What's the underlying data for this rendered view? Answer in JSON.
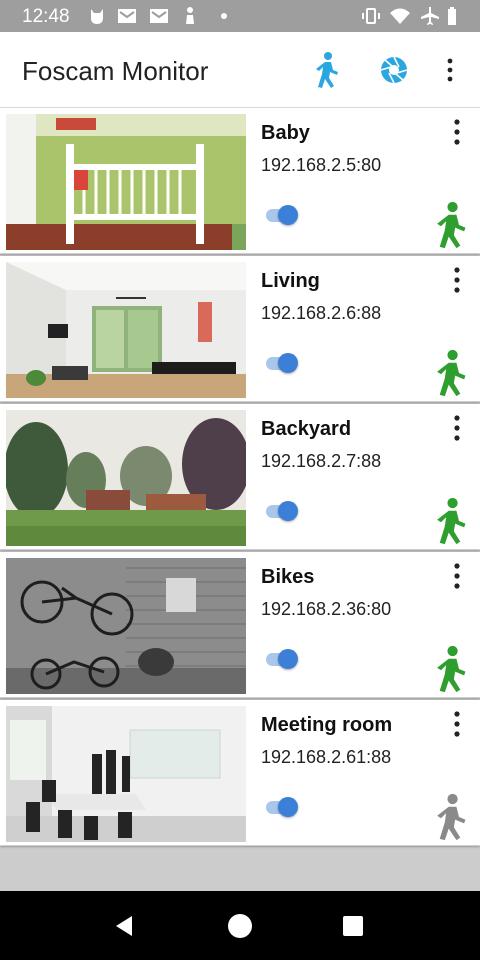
{
  "status_bar": {
    "time": "12:48",
    "left_icons": [
      "cat-notification-icon",
      "mail-icon",
      "mail-icon",
      "person-notification-icon",
      "dot-icon"
    ],
    "right_icons": [
      "vibrate-icon",
      "wifi-icon",
      "airplane-icon",
      "battery-icon"
    ]
  },
  "app_bar": {
    "title": "Foscam Monitor",
    "actions": [
      "motion-walk-icon",
      "camera-shutter-icon",
      "more-vert-icon"
    ]
  },
  "colors": {
    "accent": "#3c7fd6",
    "motion_active": "#2e9e2e",
    "motion_inactive": "#8a8a8a",
    "app_icon_blue": "#2aa7e0"
  },
  "cameras": [
    {
      "name": "Baby",
      "ip": "192.168.2.5:80",
      "enabled": true,
      "motion": "active",
      "thumb": "nursery"
    },
    {
      "name": "Living",
      "ip": "192.168.2.6:88",
      "enabled": true,
      "motion": "active",
      "thumb": "living-room"
    },
    {
      "name": "Backyard",
      "ip": "192.168.2.7:88",
      "enabled": true,
      "motion": "active",
      "thumb": "backyard"
    },
    {
      "name": "Bikes",
      "ip": "192.168.2.36:80",
      "enabled": true,
      "motion": "active",
      "thumb": "bikes-wall"
    },
    {
      "name": "Meeting room",
      "ip": "192.168.2.61:88",
      "enabled": true,
      "motion": "inactive",
      "thumb": "office"
    }
  ],
  "nav": [
    "back-icon",
    "home-icon",
    "recents-icon"
  ]
}
